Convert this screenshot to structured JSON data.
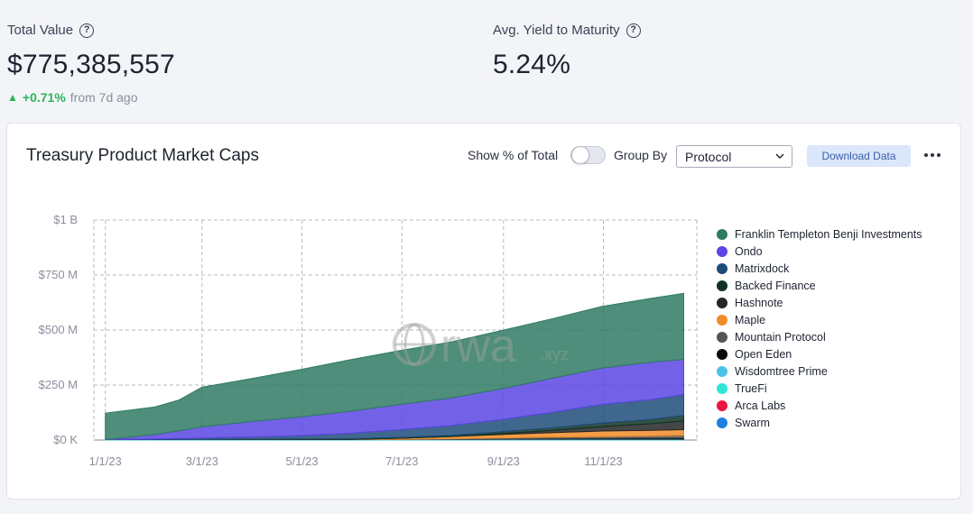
{
  "metrics": {
    "total_value": {
      "label": "Total Value",
      "value": "$775,385,557",
      "change_pct": "+0.71%",
      "change_from": "from 7d ago"
    },
    "avg_yield": {
      "label": "Avg. Yield to Maturity",
      "value": "5.24%"
    }
  },
  "card": {
    "title": "Treasury Product Market Caps",
    "show_pct_label": "Show % of Total",
    "show_pct_enabled": false,
    "group_by_label": "Group By",
    "group_by_value": "Protocol",
    "download_label": "Download Data",
    "watermark": "rwa",
    "watermark_suffix": ".xyz"
  },
  "chart_data": {
    "type": "area",
    "stacked": true,
    "x_ticks": [
      "1/1/23",
      "3/1/23",
      "5/1/23",
      "7/1/23",
      "9/1/23",
      "11/1/23"
    ],
    "y_ticks": [
      "$0 K",
      "$250 M",
      "$500 M",
      "$750 M",
      "$1 B"
    ],
    "y_range": [
      0,
      1000
    ],
    "y_unit": "M",
    "x_range": [
      "2022-12-25",
      "2023-12-28"
    ],
    "grid": true,
    "legend_position": "right",
    "x": [
      "2023-01-01",
      "2023-01-31",
      "2023-02-15",
      "2023-03-01",
      "2023-03-31",
      "2023-04-30",
      "2023-05-31",
      "2023-06-30",
      "2023-07-31",
      "2023-08-31",
      "2023-09-30",
      "2023-10-31",
      "2023-11-30",
      "2023-12-20"
    ],
    "series": [
      {
        "name": "Franklin Templeton Benji Investments",
        "color": "#2f7a64",
        "values": [
          120,
          125,
          140,
          180,
          195,
          215,
          235,
          245,
          255,
          265,
          270,
          280,
          290,
          300
        ]
      },
      {
        "name": "Ondo",
        "color": "#5b45e3",
        "values": [
          0,
          20,
          35,
          50,
          70,
          85,
          100,
          115,
          125,
          140,
          155,
          165,
          170,
          160
        ]
      },
      {
        "name": "Matrixdock",
        "color": "#1e4c7a",
        "values": [
          0,
          3,
          5,
          8,
          10,
          15,
          25,
          35,
          45,
          55,
          70,
          85,
          90,
          95
        ]
      },
      {
        "name": "Backed Finance",
        "color": "#0f3325",
        "values": [
          0,
          0,
          0,
          0,
          1,
          2,
          3,
          4,
          5,
          8,
          12,
          16,
          20,
          25
        ]
      },
      {
        "name": "Hashnote",
        "color": "#262626",
        "values": [
          0,
          0,
          0,
          0,
          0,
          0,
          0,
          0,
          0,
          5,
          10,
          20,
          30,
          40
        ]
      },
      {
        "name": "Maple",
        "color": "#f28c28",
        "values": [
          0,
          0,
          0,
          0,
          0,
          0,
          0,
          5,
          10,
          15,
          20,
          25,
          25,
          25
        ]
      },
      {
        "name": "Mountain Protocol",
        "color": "#555555",
        "values": [
          0,
          0,
          0,
          0,
          0,
          0,
          0,
          0,
          2,
          4,
          6,
          8,
          10,
          12
        ]
      },
      {
        "name": "Open Eden",
        "color": "#0a0a0a",
        "values": [
          0,
          0,
          0,
          0,
          0,
          0,
          0,
          0,
          1,
          2,
          3,
          4,
          5,
          6
        ]
      },
      {
        "name": "Wisdomtree Prime",
        "color": "#4cc3e6",
        "values": [
          1,
          1,
          1,
          1,
          2,
          2,
          2,
          2,
          2,
          3,
          3,
          3,
          3,
          3
        ]
      },
      {
        "name": "TrueFi",
        "color": "#2ee6d6",
        "values": [
          1,
          1,
          1,
          1,
          1,
          1,
          1,
          1,
          1,
          1,
          1,
          1,
          1,
          1
        ]
      },
      {
        "name": "Arca Labs",
        "color": "#e8163c",
        "values": [
          0,
          0,
          0,
          0,
          0,
          0,
          0,
          0,
          0,
          0,
          0,
          0,
          0,
          0
        ]
      },
      {
        "name": "Swarm",
        "color": "#1b7fe0",
        "values": [
          0,
          0,
          0,
          0,
          0,
          0,
          0,
          0,
          0,
          0,
          0,
          0,
          0,
          0
        ]
      }
    ]
  }
}
